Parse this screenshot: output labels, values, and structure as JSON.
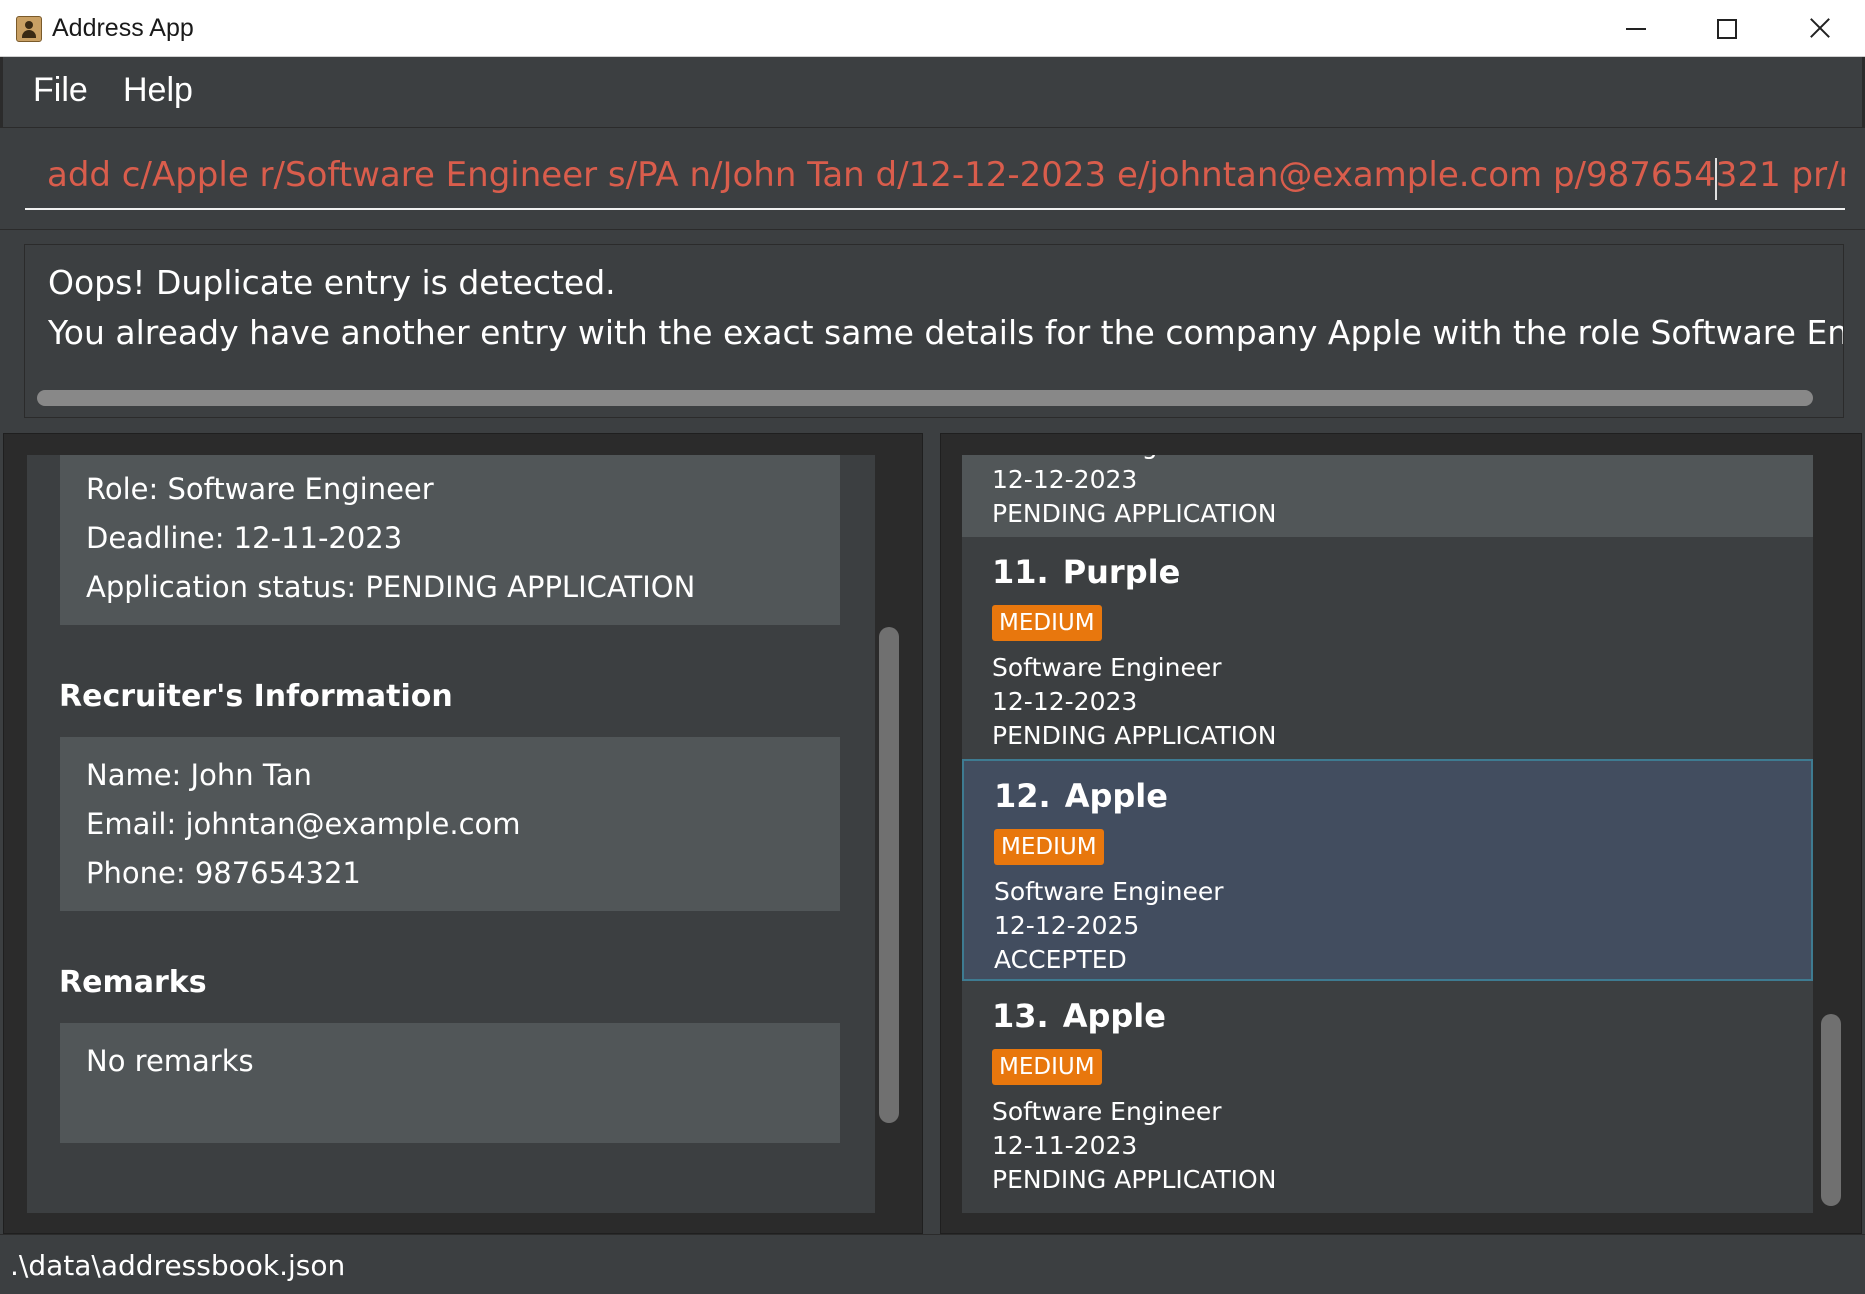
{
  "window": {
    "title": "Address App"
  },
  "menu": {
    "file": "File",
    "help": "Help"
  },
  "command": {
    "value": "add c/Apple r/Software Engineer s/PA n/John Tan d/12-12-2023 e/johntan@example.com p/987654321 pr/medium"
  },
  "result": {
    "line1": "Oops! Duplicate entry is detected.",
    "line2": "You already have another entry with the exact same details for the company Apple with the role Software Engineer at index"
  },
  "detail": {
    "role": "Role: Software Engineer",
    "deadline": "Deadline: 12-11-2023",
    "status": "Application status: PENDING APPLICATION",
    "recruiter_heading": "Recruiter's Information",
    "name": "Name: John Tan",
    "email": "Email: johntan@example.com",
    "phone": "Phone: 987654321",
    "remarks_heading": "Remarks",
    "remarks": "No remarks"
  },
  "list": {
    "partial": {
      "role": "Software Engineer",
      "date": "12-12-2023",
      "status": "PENDING APPLICATION"
    },
    "items": [
      {
        "index": "11.",
        "company": "Purple",
        "priority": "MEDIUM",
        "role": "Software Engineer",
        "date": "12-12-2023",
        "status": "PENDING APPLICATION"
      },
      {
        "index": "12.",
        "company": "Apple",
        "priority": "MEDIUM",
        "role": "Software Engineer",
        "date": "12-12-2025",
        "status": "ACCEPTED"
      },
      {
        "index": "13.",
        "company": "Apple",
        "priority": "MEDIUM",
        "role": "Software Engineer",
        "date": "12-11-2023",
        "status": "PENDING APPLICATION"
      }
    ]
  },
  "statusbar": {
    "path": ".\\data\\addressbook.json"
  },
  "colors": {
    "background": "#3c3f41",
    "card_alt": "#515658",
    "selected": "#424d5f",
    "priority_badge": "#e8770d",
    "command_text": "#d95d4c"
  }
}
